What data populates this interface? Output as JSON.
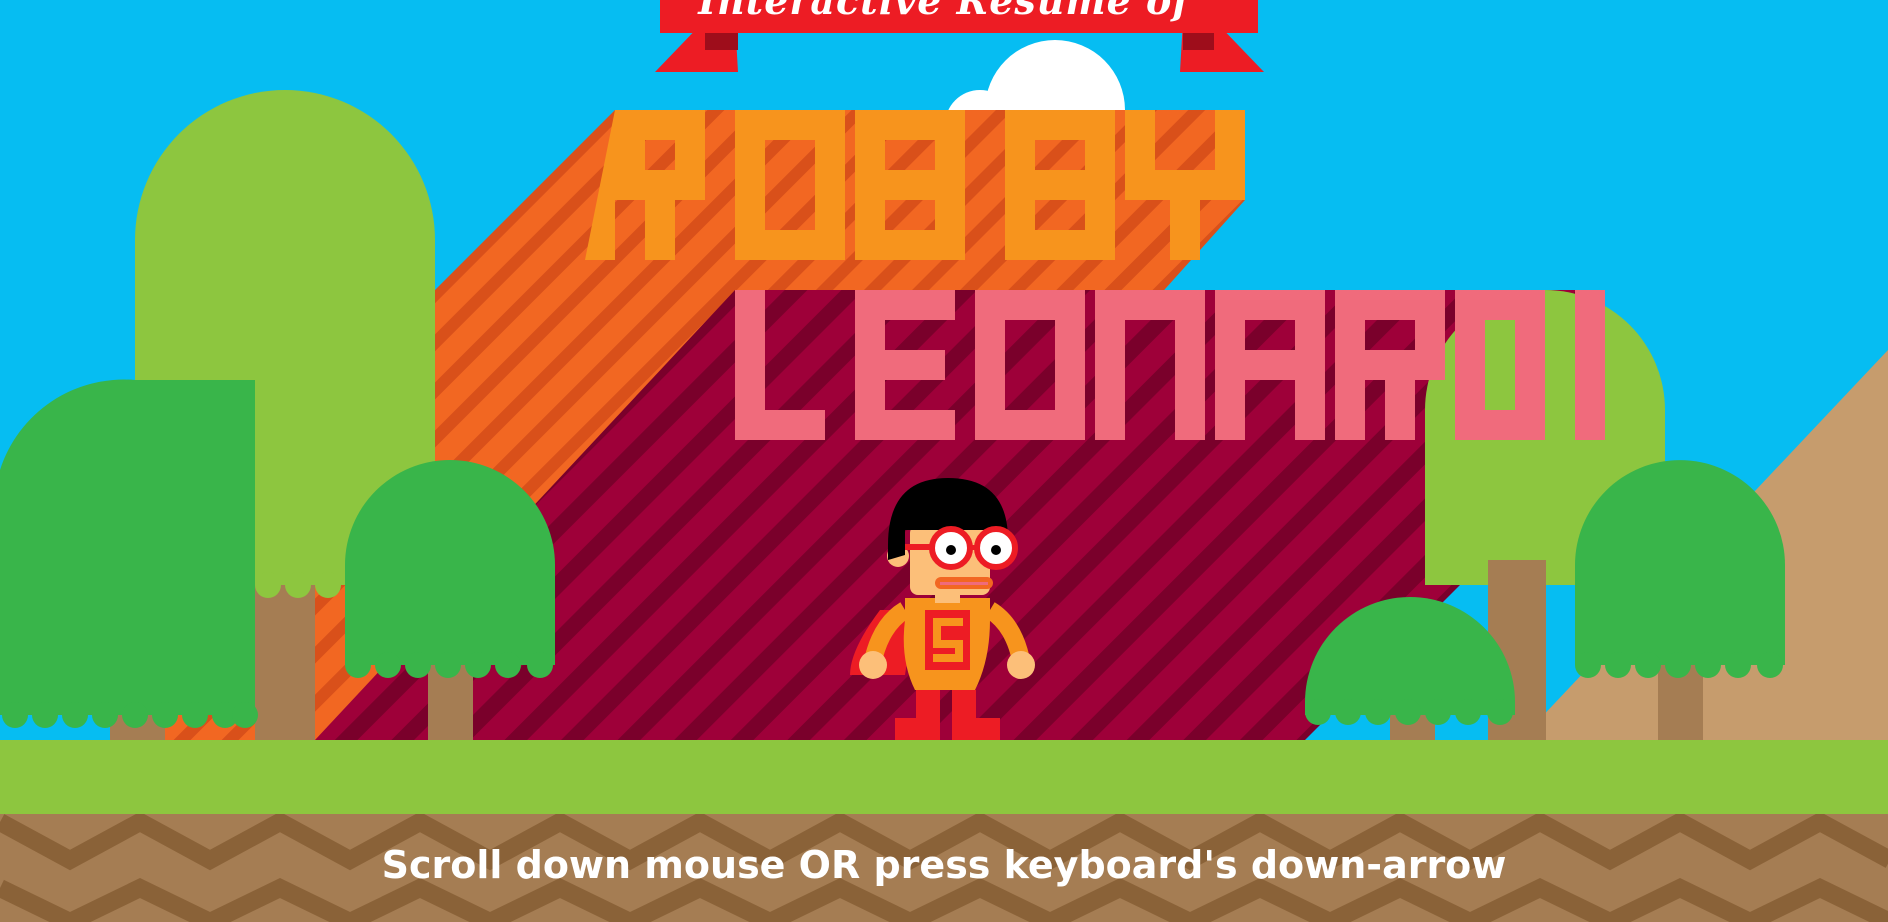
{
  "banner": {
    "text": "Interactive Resume of"
  },
  "title": {
    "first_name": "ROBBY",
    "last_name": "LEONARDI"
  },
  "hero": {
    "chest_letter": "S"
  },
  "hint": {
    "text": "Scroll down mouse OR press keyboard's down-arrow"
  },
  "colors": {
    "sky": "#06bdf2",
    "grass": "#8dc63f",
    "dirt": "#a07a4f",
    "dirt_dark": "#8a6238",
    "first_name": "#f7941d",
    "first_name_shadow": "#f26722",
    "last_name": "#f06b7c",
    "last_name_shadow": "#9e0039",
    "banner": "#ed1c24"
  }
}
